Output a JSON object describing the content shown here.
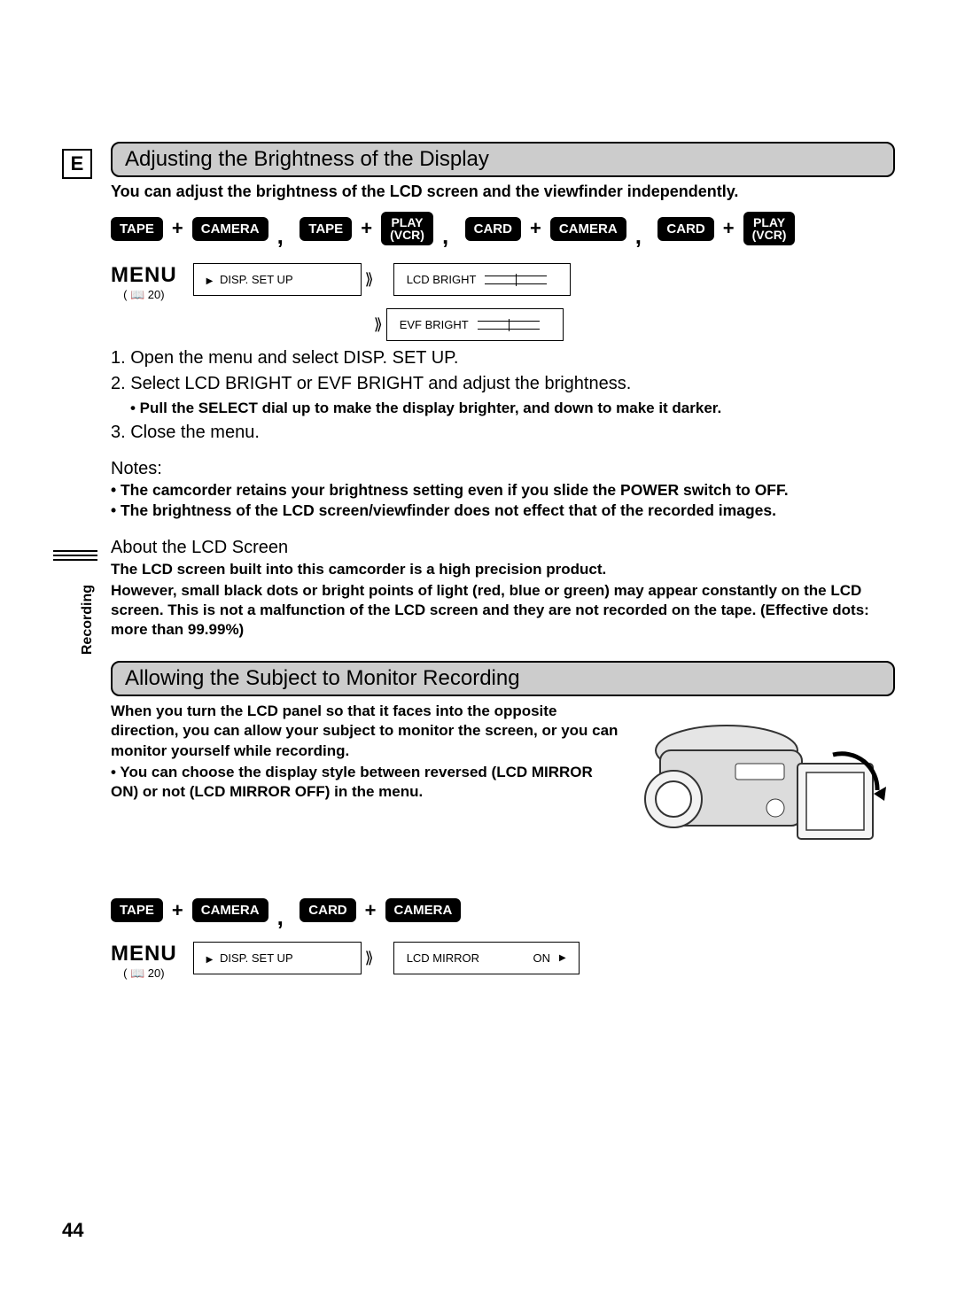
{
  "page": {
    "lang_badge": "E",
    "number": "44",
    "side_label": "Recording"
  },
  "menu_ref": "( 📖 20)",
  "section1": {
    "title": "Adjusting the Brightness of the Display",
    "intro": "You can adjust the brightness of the LCD screen and the viewfinder independently.",
    "modes": {
      "tape": "TAPE",
      "camera": "CAMERA",
      "play_vcr": "PLAY\n(VCR)",
      "card": "CARD",
      "plus": "+",
      "comma": ","
    },
    "menu": {
      "label": "MENU",
      "path_item": "DISP. SET UP",
      "setting_a": "LCD BRIGHT",
      "setting_b": "EVF BRIGHT"
    },
    "steps": {
      "s1": "1. Open the menu and select DISP. SET UP.",
      "s2": "2. Select LCD BRIGHT or EVF BRIGHT and adjust the brightness.",
      "s2_sub": "• Pull the SELECT dial up to make the display brighter, and down to make it darker.",
      "s3": "3. Close the menu."
    },
    "notes_heading": "Notes:",
    "notes": {
      "n1": "• The camcorder retains your brightness setting even if you slide the POWER switch to OFF.",
      "n2": "• The brightness of the LCD screen/viewfinder does not effect that of the recorded images."
    },
    "about_heading": "About the LCD Screen",
    "about": {
      "l1": "The LCD screen built into this camcorder is a high precision product.",
      "l2": "However, small black dots or bright points of light (red, blue or green) may appear constantly on the LCD screen. This is not a malfunction of the LCD screen and they are not recorded on the tape. (Effective dots: more than 99.99%)"
    }
  },
  "section2": {
    "title": "Allowing the Subject to Monitor Recording",
    "para": {
      "l1": "When you turn the LCD panel so that it faces into the opposite direction, you can allow your subject to monitor the screen, or you can monitor yourself while recording.",
      "l2": "• You can choose the display style between reversed (LCD MIRROR ON) or not (LCD MIRROR OFF) in the menu."
    },
    "menu": {
      "label": "MENU",
      "path_item": "DISP. SET UP",
      "setting": "LCD MIRROR",
      "value": "ON",
      "arrow": "▶"
    }
  }
}
